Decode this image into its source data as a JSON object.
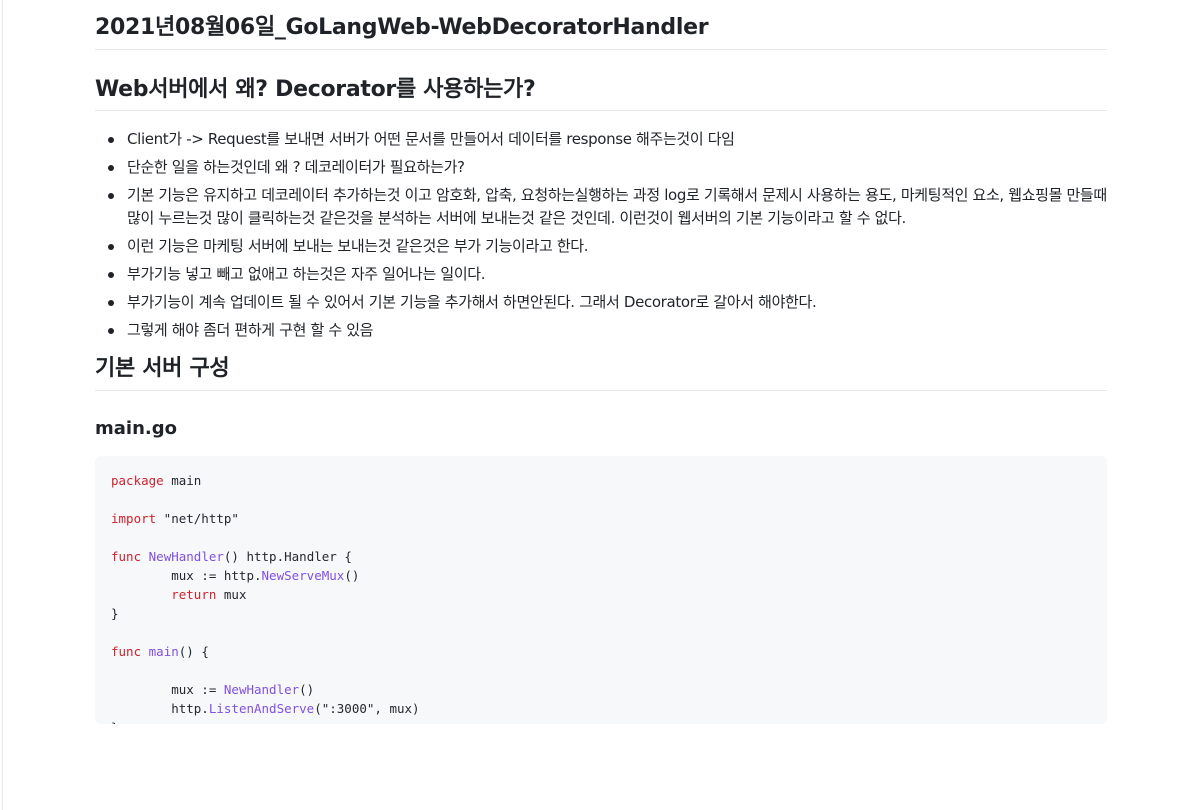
{
  "page": {
    "title": "2021년08월06일_GoLangWeb-WebDecoratorHandler"
  },
  "section1": {
    "heading": "Web서버에서 왜? Decorator를 사용하는가?",
    "bullets": [
      "Client가 -> Request를 보내면 서버가 어떤 문서를 만들어서 데이터를 response 해주는것이 다임",
      "단순한 일을 하는것인데 왜 ? 데코레이터가 필요하는가?",
      "기본 기능은 유지하고 데코레이터 추가하는것 이고 암호화, 압축, 요청하는실행하는 과정 log로 기록해서 문제시 사용하는 용도, 마케팅적인 요소, 웹쇼핑몰 만들때 많이 누르는것 많이 클릭하는것 같은것을 분석하는 서버에 보내는것 같은 것인데. 이런것이 웹서버의 기본 기능이라고 할 수 없다.",
      "이런 기능은 마케팅 서버에 보내는 보내는것 같은것은 부가 기능이라고 한다.",
      "부가기능 넣고 빼고 없애고 하는것은 자주 일어나는 일이다.",
      "부가기능이 계속 업데이트 될 수 있어서 기본 기능을 추가해서 하면안된다. 그래서 Decorator로 갈아서 해야한다.",
      "그렇게 해야 좀더 편하게 구현 할 수 있음"
    ]
  },
  "section2": {
    "heading": "기본 서버 구성",
    "file_title": "main.go",
    "code": {
      "l1_kw": "package",
      "l1_rest": " main",
      "l3_kw": "import",
      "l3_rest": " \"net/http\"",
      "l5_kw": "func",
      "l5_fn": "NewHandler",
      "l5_rest": "() http.Handler {",
      "l6_pre": "        mux := http.",
      "l6_fn": "NewServeMux",
      "l6_rest": "()",
      "l7_pre": "        ",
      "l7_kw": "return",
      "l7_rest": " mux",
      "l8": "}",
      "l10_kw": "func",
      "l10_fn": "main",
      "l10_rest": "() {",
      "l12_pre": "        mux := ",
      "l12_fn": "NewHandler",
      "l12_rest": "()",
      "l13_pre": "        http.",
      "l13_fn": "ListenAndServe",
      "l13_rest": "(\":3000\", mux)",
      "l14": "}"
    }
  },
  "colors": {
    "keyword": "#cf222e",
    "function": "#8250df",
    "code_background": "#f6f8fa",
    "rule": "#e7e9ec"
  }
}
